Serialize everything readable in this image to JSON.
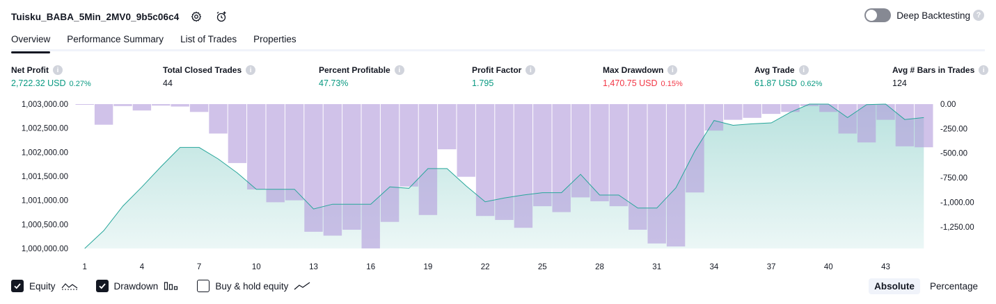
{
  "header": {
    "strategy_name": "Tuisku_BABA_5Min_2MV0_9b5c06c4",
    "icons": [
      "settings-icon",
      "alarm-add-icon"
    ]
  },
  "deep_backtesting": {
    "label": "Deep Backtesting",
    "enabled": false,
    "help": "?"
  },
  "tabs": [
    {
      "label": "Overview",
      "active": true
    },
    {
      "label": "Performance Summary",
      "active": false
    },
    {
      "label": "List of Trades",
      "active": false
    },
    {
      "label": "Properties",
      "active": false
    }
  ],
  "metrics": [
    {
      "label": "Net Profit",
      "value": "2,722.32 USD",
      "pct": "0.27%",
      "color": "#089981"
    },
    {
      "label": "Total Closed Trades",
      "value": "44",
      "pct": "",
      "color": "#131722"
    },
    {
      "label": "Percent Profitable",
      "value": "47.73%",
      "pct": "",
      "color": "#089981"
    },
    {
      "label": "Profit Factor",
      "value": "1.795",
      "pct": "",
      "color": "#089981"
    },
    {
      "label": "Max Drawdown",
      "value": "1,470.75 USD",
      "pct": "0.15%",
      "color": "#f23645"
    },
    {
      "label": "Avg Trade",
      "value": "61.87 USD",
      "pct": "0.62%",
      "color": "#089981"
    },
    {
      "label": "Avg # Bars in Trades",
      "value": "124",
      "pct": "",
      "color": "#131722"
    }
  ],
  "chart_data": {
    "type": "area",
    "equity_axis": {
      "ticks": [
        "1,003,000.00",
        "1,002,500.00",
        "1,002,000.00",
        "1,001,500.00",
        "1,001,000.00",
        "1,000,500.00",
        "1,000,000.00"
      ],
      "ylim": [
        1000000,
        1003000
      ]
    },
    "drawdown_axis": {
      "ticks": [
        "0.00",
        "-250.00",
        "-500.00",
        "-750.00",
        "-1,000.00",
        "-1,250.00"
      ],
      "ylim": [
        -1470.75,
        0
      ]
    },
    "x_ticks": [
      "1",
      "4",
      "7",
      "10",
      "13",
      "16",
      "19",
      "22",
      "25",
      "28",
      "31",
      "34",
      "37",
      "40",
      "43"
    ],
    "series": [
      {
        "name": "Equity",
        "color": "#26a69a",
        "x": [
          1,
          2,
          3,
          4,
          5,
          6,
          7,
          8,
          9,
          10,
          11,
          12,
          13,
          14,
          15,
          16,
          17,
          18,
          19,
          20,
          21,
          22,
          23,
          24,
          25,
          26,
          27,
          28,
          29,
          30,
          31,
          32,
          33,
          34,
          35,
          36,
          37,
          38,
          39,
          40,
          41,
          42,
          43,
          44,
          45
        ],
        "values": [
          1000000,
          1000370,
          1000880,
          1001280,
          1001700,
          1002100,
          1002100,
          1001860,
          1001570,
          1001230,
          1001230,
          1001230,
          1000820,
          1000920,
          1000920,
          1000920,
          1001280,
          1001250,
          1001660,
          1001660,
          1001300,
          1000970,
          1001050,
          1001110,
          1001160,
          1001160,
          1001540,
          1001110,
          1001110,
          1000840,
          1000840,
          1001260,
          1002030,
          1002660,
          1002560,
          1002590,
          1002610,
          1002830,
          1003000,
          1003000,
          1002720,
          1002990,
          1003000,
          1002680,
          1002720
        ]
      },
      {
        "name": "Drawdown",
        "color": "#b39ddb",
        "x": [
          1,
          2,
          3,
          4,
          5,
          6,
          7,
          8,
          9,
          10,
          11,
          12,
          13,
          14,
          15,
          16,
          17,
          18,
          19,
          20,
          21,
          22,
          23,
          24,
          25,
          26,
          27,
          28,
          29,
          30,
          31,
          32,
          33,
          34,
          35,
          36,
          37,
          38,
          39,
          40,
          41,
          42,
          43,
          44,
          45
        ],
        "values": [
          0,
          -210,
          -20,
          -65,
          -15,
          -25,
          -80,
          -300,
          -600,
          -870,
          -1000,
          -980,
          -1300,
          -1340,
          -1280,
          -1470,
          -1200,
          -840,
          -1130,
          -460,
          -740,
          -1140,
          -1180,
          -1260,
          -1040,
          -1100,
          -950,
          -990,
          -1040,
          -1280,
          -1420,
          -1450,
          -900,
          -270,
          -160,
          -140,
          -100,
          -80,
          -20,
          -80,
          -300,
          -390,
          -160,
          -430,
          -440
        ]
      }
    ],
    "legend": [
      {
        "label": "Equity",
        "checked": true,
        "icon": "equity-line-icon"
      },
      {
        "label": "Drawdown",
        "checked": true,
        "icon": "drawdown-bars-icon"
      },
      {
        "label": "Buy & hold equity",
        "checked": false,
        "icon": "buy-hold-line-icon"
      }
    ]
  },
  "modes": [
    {
      "label": "Absolute",
      "active": true
    },
    {
      "label": "Percentage",
      "active": false
    }
  ]
}
